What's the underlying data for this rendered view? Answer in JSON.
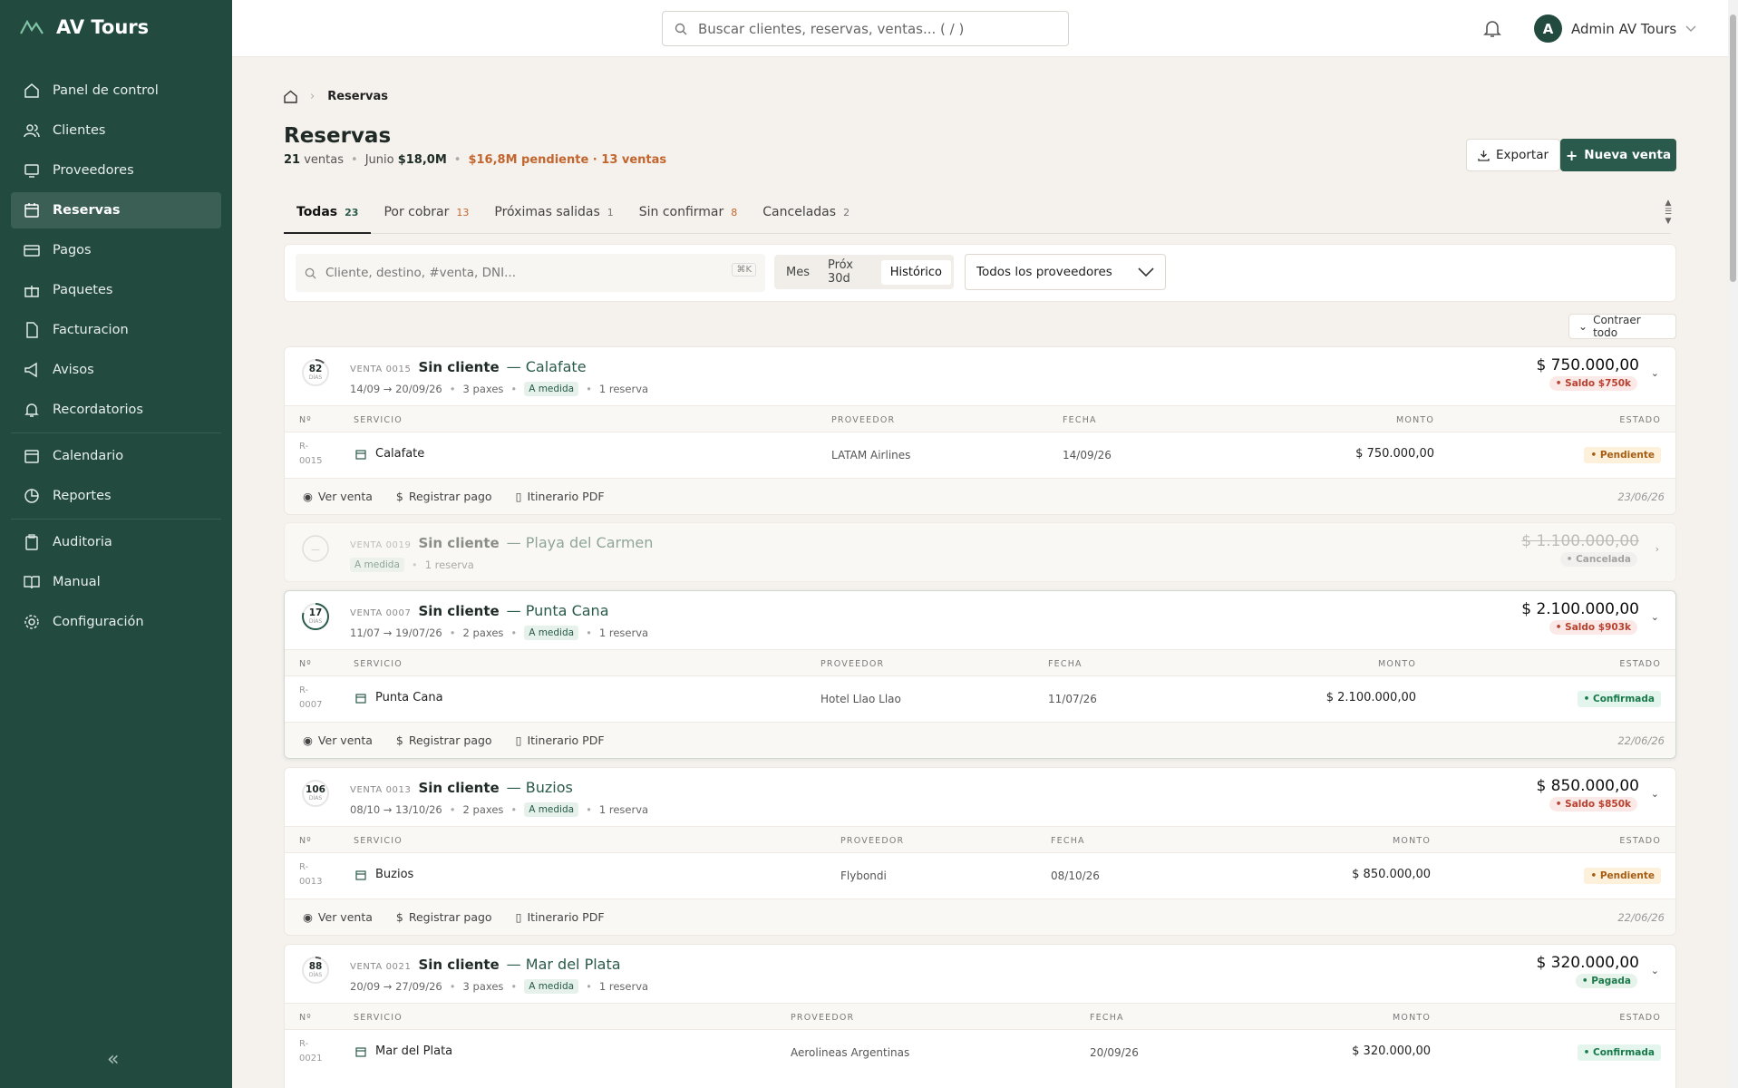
{
  "app": {
    "brand": "AV Tours"
  },
  "sidebar": {
    "items": [
      {
        "label": "Panel de control",
        "icon": "home-icon"
      },
      {
        "label": "Clientes",
        "icon": "users-icon"
      },
      {
        "label": "Proveedores",
        "icon": "monitor-icon"
      },
      {
        "label": "Reservas",
        "icon": "calendar-icon",
        "active": true
      },
      {
        "label": "Pagos",
        "icon": "card-icon"
      },
      {
        "label": "Paquetes",
        "icon": "gift-icon"
      },
      {
        "label": "Facturacion",
        "icon": "doc-icon"
      },
      {
        "label": "Avisos",
        "icon": "megaphone-icon"
      },
      {
        "label": "Recordatorios",
        "icon": "bell-icon"
      },
      {
        "label": "Calendario",
        "icon": "calendar-icon"
      },
      {
        "label": "Reportes",
        "icon": "chart-icon"
      },
      {
        "label": "Auditoria",
        "icon": "clipboard-icon"
      },
      {
        "label": "Manual",
        "icon": "book-icon"
      },
      {
        "label": "Configuración",
        "icon": "gear-icon"
      }
    ],
    "collapse": "«"
  },
  "topbar": {
    "search_placeholder": "Buscar clientes, reservas, ventas... ( / )",
    "user": "Admin AV Tours",
    "avatar": "A"
  },
  "page": {
    "crumb": "Reservas",
    "title": "Reservas",
    "sub": {
      "ventas_n": "21",
      "ventas": "ventas",
      "mes": "Junio",
      "mes_total": "$18,0M",
      "pendiente": "$16,8M pendiente · 13 ventas"
    },
    "export": "Exportar",
    "new": "Nueva venta",
    "tabs": [
      {
        "label": "Todas",
        "count": "23"
      },
      {
        "label": "Por cobrar",
        "count": "13"
      },
      {
        "label": "Próximas salidas",
        "count": "1"
      },
      {
        "label": "Sin confirmar",
        "count": "8"
      },
      {
        "label": "Canceladas",
        "count": "2"
      }
    ],
    "filter": {
      "placeholder": "Cliente, destino, #venta, DNI...",
      "kbd": "⌘K",
      "seg": [
        "Mes",
        "Próx 30d",
        "Histórico"
      ],
      "provider": "Todos los proveedores"
    },
    "collapse_all": "Contraer todo"
  },
  "table_headers": {
    "n": "Nº",
    "servicio": "SERVICIO",
    "proveedor": "PROVEEDOR",
    "fecha": "FECHA",
    "monto": "MONTO",
    "estado": "ESTADO"
  },
  "actions": {
    "ver": "Ver venta",
    "pago": "Registrar pago",
    "pdf": "Itinerario PDF"
  },
  "cards": [
    {
      "days": "82",
      "days_lbl": "DÍAS",
      "venta": "VENTA 0015",
      "client": "Sin cliente",
      "dest": "— Calafate",
      "dates": "14/09 → 20/09/26",
      "pax": "3 paxes",
      "tag": "A medida",
      "res": "1 reserva",
      "amount": "$ 750.000,00",
      "pill": "• Saldo $750k",
      "rid1": "R-",
      "rid2": "0015",
      "svc": "Calafate",
      "prov": "LATAM Airlines",
      "fecha": "14/09/26",
      "monto": "$ 750.000,00",
      "status": "• Pendiente",
      "fdate": "23/06/26"
    },
    {
      "venta": "VENTA 0019",
      "client": "Sin cliente",
      "dest": "— Playa del Carmen",
      "tag": "A medida",
      "res": "1 reserva",
      "amount": "$ 1.100.000,00",
      "pill": "• Cancelada",
      "dash": "—"
    },
    {
      "days": "17",
      "days_lbl": "DÍAS",
      "venta": "VENTA 0007",
      "client": "Sin cliente",
      "dest": "— Punta Cana",
      "dates": "11/07 → 19/07/26",
      "pax": "2 paxes",
      "tag": "A medida",
      "res": "1 reserva",
      "amount": "$ 2.100.000,00",
      "pill": "• Saldo $903k",
      "rid1": "R-",
      "rid2": "0007",
      "svc": "Punta Cana",
      "prov": "Hotel Llao Llao",
      "fecha": "11/07/26",
      "monto": "$ 2.100.000,00",
      "status": "• Confirmada",
      "fdate": "22/06/26"
    },
    {
      "days": "106",
      "days_lbl": "DÍAS",
      "venta": "VENTA 0013",
      "client": "Sin cliente",
      "dest": "— Buzios",
      "dates": "08/10 → 13/10/26",
      "pax": "2 paxes",
      "tag": "A medida",
      "res": "1 reserva",
      "amount": "$ 850.000,00",
      "pill": "• Saldo $850k",
      "rid1": "R-",
      "rid2": "0013",
      "svc": "Buzios",
      "prov": "Flybondi",
      "fecha": "08/10/26",
      "monto": "$ 850.000,00",
      "status": "• Pendiente",
      "fdate": "22/06/26"
    },
    {
      "days": "88",
      "days_lbl": "DÍAS",
      "venta": "VENTA 0021",
      "client": "Sin cliente",
      "dest": "— Mar del Plata",
      "dates": "20/09 → 27/09/26",
      "pax": "3 paxes",
      "tag": "A medida",
      "res": "1 reserva",
      "amount": "$ 320.000,00",
      "pill": "• Pagada",
      "rid1": "R-",
      "rid2": "0021",
      "svc": "Mar del Plata",
      "prov": "Aerolineas Argentinas",
      "fecha": "20/09/26",
      "monto": "$ 320.000,00",
      "status": "• Confirmada"
    }
  ],
  "colors": {
    "sidebar": "#234a3f",
    "accent": "#2a5a4b",
    "warn": "#c2662f"
  }
}
